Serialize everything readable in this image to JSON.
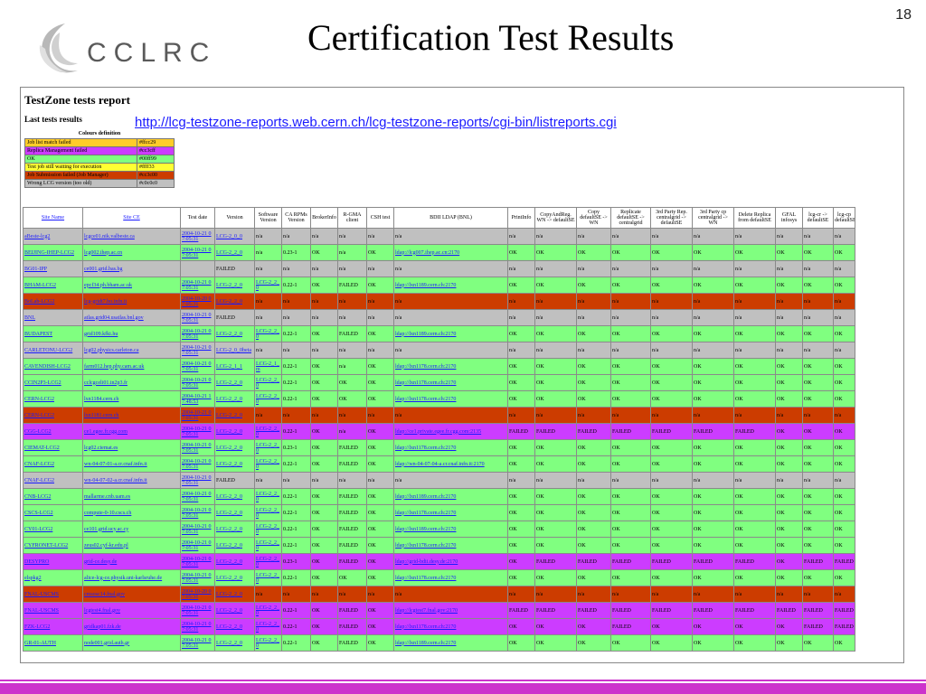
{
  "slide": {
    "number": "18",
    "title": "Certification Test Results",
    "logo_text": "CCLRC"
  },
  "report": {
    "title": "TestZone tests report",
    "last_results": "Last tests results",
    "url": "http://lcg-testzone-reports.web.cern.ch/lcg-testzone-reports/cgi-bin/listreports.cgi"
  },
  "legend": {
    "header": "Colours definition",
    "items": [
      {
        "label": "Job list match failed",
        "code": "#ffcc29",
        "color": "#ffcc29"
      },
      {
        "label": "Replica Management failed",
        "code": "#cc3cff",
        "color": "#cc3cff"
      },
      {
        "label": "OK",
        "code": "#00ff99",
        "color": "#80ff80"
      },
      {
        "label": "Test job still waiting for execution",
        "code": "#ffff33",
        "color": "#ffff33"
      },
      {
        "label": "Job Submission failed (Job Manager)",
        "code": "#cc3c00",
        "color": "#cc3c00"
      },
      {
        "label": "Wrong LCG version (too old)",
        "code": "#c0c0c0",
        "color": "#c0c0c0"
      }
    ]
  },
  "colors": {
    "ok": "#80ff80",
    "fail": "#cc3c00",
    "gray": "#c0c0c0",
    "rm": "#cc3cff",
    "link": "#1a1aff"
  },
  "table": {
    "headers": [
      "Site Name",
      "Site CE",
      "Test date",
      "Version",
      "Software Version",
      "CA RPMs Version",
      "BrokerInfo",
      "R-GMA client",
      "CSH test",
      "BDII LDAP (BNL)",
      "PrintInfo",
      "CopyAndReg. WN -> defaultSE",
      "Copy defaultSE -> WN",
      "Replicate defaultSE -> centralgrid",
      "3rd Party Rep. centralgrid -> defaultSE",
      "3rd Party cp centralgrid -> WN",
      "Delete Replica from defaultSE",
      "GFAL infosys",
      "lcg-cr -> defaultSE",
      "lcg-cp defaultSE"
    ],
    "rows": [
      {
        "row": "gray",
        "cells": [
          "aBeste-lcg2",
          "lcgce01.nik.valbeste.ca",
          "2004-10-21 07:05:31",
          "LCG-2_0_0",
          "n/a",
          "n/a",
          "n/a",
          "n/a",
          "n/a",
          "n/a",
          "n/a",
          "n/a",
          "n/a",
          "n/a",
          "n/a",
          "n/a",
          "n/a",
          "n/a",
          "n/a",
          "n/a"
        ]
      },
      {
        "row": "ok",
        "cells": [
          "BEIJING-IHEP-LCG2",
          "lcg002.ihep.ac.cn",
          "2004-10-21 07:05:31",
          "LCG-2_2_0",
          "n/a",
          "0.23-1",
          "OK",
          "n/a",
          "OK",
          "ldap://lcg007.ihep.ac.cn:2170",
          "OK",
          "OK",
          "OK",
          "OK",
          "OK",
          "OK",
          "OK",
          "OK",
          "OK",
          "OK"
        ]
      },
      {
        "row": "gray",
        "cells": [
          "BG01-IPP",
          "ce001.grid.bas.bg",
          "",
          "FAILED",
          "n/a",
          "n/a",
          "n/a",
          "n/a",
          "n/a",
          "n/a",
          "n/a",
          "n/a",
          "n/a",
          "n/a",
          "n/a",
          "n/a",
          "n/a",
          "n/a",
          "n/a",
          "n/a"
        ]
      },
      {
        "row": "ok",
        "cells": [
          "BHAM-LCG2",
          "epcf34.ph.bham.ac.uk",
          "2004-10-21 07:05:31",
          "LCG-2_2_0",
          "LCG-2_2_0",
          "0.22-1",
          "OK",
          "FAILED",
          "OK",
          "ldap://lxn1189.cern.ch:2170",
          "OK",
          "OK",
          "OK",
          "OK",
          "OK",
          "OK",
          "OK",
          "OK",
          "OK",
          "OK"
        ]
      },
      {
        "row": "fail",
        "cells": [
          "BoLab-LCG2",
          "lcg-gridt7.bo.infn.it",
          "2004-10-20 07:05:31",
          "LCG-2_2_0",
          "n/a",
          "n/a",
          "n/a",
          "n/a",
          "n/a",
          "n/a",
          "n/a",
          "n/a",
          "n/a",
          "n/a",
          "n/a",
          "n/a",
          "n/a",
          "n/a",
          "n/a",
          "n/a"
        ]
      },
      {
        "row": "gray",
        "cells": [
          "BNL",
          "atlas.grid04.usatlas.bnl.gov",
          "2004-10-21 07:05:31",
          "FAILED",
          "n/a",
          "n/a",
          "n/a",
          "n/a",
          "n/a",
          "n/a",
          "n/a",
          "n/a",
          "n/a",
          "n/a",
          "n/a",
          "n/a",
          "n/a",
          "n/a",
          "n/a",
          "n/a"
        ]
      },
      {
        "row": "ok",
        "cells": [
          "BUDAPEST",
          "grid109.kfki.hu",
          "2004-10-21 07:05:31",
          "LCG-2_2_0",
          "LCG-2_2_0",
          "0.22-1",
          "OK",
          "FAILED",
          "OK",
          "ldap://lxn1189.cern.ch:2170",
          "OK",
          "OK",
          "OK",
          "OK",
          "OK",
          "OK",
          "OK",
          "OK",
          "OK",
          "OK"
        ]
      },
      {
        "row": "gray",
        "cells": [
          "CARLETONU-LCG2",
          "lcg02.physics.carleton.ca",
          "2004-10-21 07:05:31",
          "LCG-2_0_0beta",
          "n/a",
          "n/a",
          "n/a",
          "n/a",
          "n/a",
          "n/a",
          "n/a",
          "n/a",
          "n/a",
          "n/a",
          "n/a",
          "n/a",
          "n/a",
          "n/a",
          "n/a",
          "n/a"
        ]
      },
      {
        "row": "ok",
        "cells": [
          "CAVENDISH-LCG2",
          "farm012.hep.phy.cam.ac.uk",
          "2004-10-21 07:05:31",
          "LCG-2_1_1",
          "LCG-2_1_m",
          "0.22-1",
          "OK",
          "n/a",
          "OK",
          "ldap://lxn1178.cern.ch:2170",
          "OK",
          "OK",
          "OK",
          "OK",
          "OK",
          "OK",
          "OK",
          "OK",
          "OK",
          "OK"
        ]
      },
      {
        "row": "ok",
        "cells": [
          "CCIN2P3-LCG2",
          "cclcgceli01.in2p3.fr",
          "2004-10-21 07:05:31",
          "LCG-2_2_0",
          "LCG-2_2_0",
          "0.22-1",
          "OK",
          "OK",
          "OK",
          "ldap://lxn1178.cern.ch:2170",
          "OK",
          "OK",
          "OK",
          "OK",
          "OK",
          "OK",
          "OK",
          "OK",
          "OK",
          "OK"
        ]
      },
      {
        "row": "ok",
        "cells": [
          "CERN-LCG2",
          "lxn1184.cern.ch",
          "2004-10-21 17:48:53",
          "LCG-2_2_0",
          "LCG-2_2_0",
          "0.22-1",
          "OK",
          "OK",
          "OK",
          "ldap://lxn1178.cern.ch:2170",
          "OK",
          "OK",
          "OK",
          "OK",
          "OK",
          "OK",
          "OK",
          "OK",
          "OK",
          "OK"
        ]
      },
      {
        "row": "fail",
        "cells": [
          "CERN-LCG2",
          "lxn1181.cern.ch",
          "2004-10-21 07:05:31",
          "LCG-2_2_0",
          "n/a",
          "n/a",
          "n/a",
          "n/a",
          "n/a",
          "n/a",
          "n/a",
          "n/a",
          "n/a",
          "n/a",
          "n/a",
          "n/a",
          "n/a",
          "n/a",
          "n/a",
          "n/a"
        ]
      },
      {
        "row": "rm",
        "cells": [
          "CGG-LCG2",
          "ce1.egee.fr.cgg.com",
          "2004-10-21 07:05:31",
          "LCG-2_2_0",
          "LCG-2_2_0",
          "0.22-1",
          "OK",
          "n/a",
          "OK",
          "ldap://ce1.private.egee.fr.cgg.com:2135",
          "FAILED",
          "FAILED",
          "FAILED",
          "FAILED",
          "FAILED",
          "FAILED",
          "FAILED",
          "OK",
          "OK",
          "OK"
        ]
      },
      {
        "row": "ok",
        "cells": [
          "CIEMAT-LCG2",
          "lcg02.ciemat.es",
          "2004-10-21 07:05:31",
          "LCG-2_2_0",
          "LCG-2_2_0",
          "0.23-1",
          "OK",
          "FAILED",
          "OK",
          "ldap://lxn1178.cern.ch:2170",
          "OK",
          "OK",
          "OK",
          "OK",
          "OK",
          "OK",
          "OK",
          "OK",
          "OK",
          "OK"
        ]
      },
      {
        "row": "ok",
        "cells": [
          "CNAF-LCG2",
          "wn-04-07-01-a.cr.cnaf.infn.it",
          "2004-10-21 07:05:31",
          "LCG-2_2_0",
          "LCG-2_2_0",
          "0.22-1",
          "OK",
          "FAILED",
          "OK",
          "ldap://wn-04-07-04-a.cr.cnaf.infn.it:2170",
          "OK",
          "OK",
          "OK",
          "OK",
          "OK",
          "OK",
          "OK",
          "OK",
          "OK",
          "OK"
        ]
      },
      {
        "row": "gray",
        "cells": [
          "CNAF-LCG2",
          "wn-04-07-02-a.cr.cnaf.infn.it",
          "2004-10-21 07:05:31",
          "FAILED",
          "n/a",
          "n/a",
          "n/a",
          "n/a",
          "n/a",
          "n/a",
          "n/a",
          "n/a",
          "n/a",
          "n/a",
          "n/a",
          "n/a",
          "n/a",
          "n/a",
          "n/a",
          "n/a"
        ]
      },
      {
        "row": "ok",
        "cells": [
          "CNB-LCG2",
          "mallarme.cnb.uam.es",
          "2004-10-21 07:05:31",
          "LCG-2_2_0",
          "LCG-2_2_0",
          "0.22-1",
          "OK",
          "FAILED",
          "OK",
          "ldap://lxn1189.cern.ch:2170",
          "OK",
          "OK",
          "OK",
          "OK",
          "OK",
          "OK",
          "OK",
          "OK",
          "OK",
          "OK"
        ]
      },
      {
        "row": "ok",
        "cells": [
          "CSCS-LCG2",
          "compute-0-10.cscs.ch",
          "2004-10-21 07:05:31",
          "LCG-2_2_0",
          "LCG-2_2_0",
          "0.22-1",
          "OK",
          "FAILED",
          "OK",
          "ldap://lxn1178.cern.ch:2170",
          "OK",
          "OK",
          "OK",
          "OK",
          "OK",
          "OK",
          "OK",
          "OK",
          "OK",
          "OK"
        ]
      },
      {
        "row": "ok",
        "cells": [
          "CY01-LCG2",
          "ce101.grid.ucy.ac.cy",
          "2004-10-21 07:05:31",
          "LCG-2_2_0",
          "LCG-2_2_0",
          "0.22-1",
          "OK",
          "FAILED",
          "OK",
          "ldap://lxn1189.cern.ch:2170",
          "OK",
          "OK",
          "OK",
          "OK",
          "OK",
          "OK",
          "OK",
          "OK",
          "OK",
          "OK"
        ]
      },
      {
        "row": "ok",
        "cells": [
          "CYFRONET-LCG2",
          "zeus02.cyf-kr.edu.pl",
          "2004-10-21 07:05:31",
          "LCG-2_2_0",
          "LCG-2_2_0",
          "0.22-1",
          "OK",
          "FAILED",
          "OK",
          "ldap://lxn1178.cern.ch:2170",
          "OK",
          "OK",
          "OK",
          "OK",
          "OK",
          "OK",
          "OK",
          "OK",
          "OK",
          "OK"
        ]
      },
      {
        "row": "rm",
        "cells": [
          "DESYPRO",
          "grid-ce.desy.de",
          "2004-10-21 07:05:31",
          "LCG-2_2_0",
          "LCG-2_2_0",
          "0.23-1",
          "OK",
          "FAILED",
          "OK",
          "ldap://grid-bdii.desy.de:2170",
          "OK",
          "FAILED",
          "FAILED",
          "FAILED",
          "FAILED",
          "FAILED",
          "FAILED",
          "OK",
          "FAILED",
          "FAILED"
        ]
      },
      {
        "row": "ok",
        "cells": [
          "elspkg2",
          "alice-lcg-ce.physik.uni-karlsruhe.de",
          "2004-10-21 07:05:31",
          "LCG-2_2_0",
          "LCG-2_2_0",
          "0.22-1",
          "OK",
          "OK",
          "OK",
          "ldap://lxn1178.cern.ch:2170",
          "OK",
          "OK",
          "OK",
          "OK",
          "OK",
          "OK",
          "OK",
          "OK",
          "OK",
          "OK"
        ]
      },
      {
        "row": "fail",
        "cells": [
          "FNAL-USCMS",
          "cmsosc14.fnal.gov",
          "2004-10-20 07:05:31",
          "LCG-2_2_0",
          "n/a",
          "n/a",
          "n/a",
          "n/a",
          "n/a",
          "n/a",
          "n/a",
          "n/a",
          "n/a",
          "n/a",
          "n/a",
          "n/a",
          "n/a",
          "n/a",
          "n/a",
          "n/a"
        ]
      },
      {
        "row": "rm",
        "cells": [
          "FNAL-USCMS",
          "lcgtest4.fnal.gov",
          "2004-10-21 07:05:31",
          "LCG-2_2_0",
          "LCG-2_2_0",
          "0.22-1",
          "OK",
          "FAILED",
          "OK",
          "ldap://lcgtest7.fnal.gov:2170",
          "FAILED",
          "FAILED",
          "FAILED",
          "FAILED",
          "FAILED",
          "FAILED",
          "FAILED",
          "FAILED",
          "FAILED",
          "FAILED"
        ]
      },
      {
        "row": "rm",
        "cells": [
          "FZK-LCG2",
          "gridkap01.fzk.de",
          "2004-10-21 07:05:31",
          "LCG-2_2_0",
          "LCG-2_2_0",
          "0.22-1",
          "OK",
          "FAILED",
          "OK",
          "ldap://lxn1178.cern.ch:2170",
          "OK",
          "OK",
          "OK",
          "FAILED",
          "OK",
          "OK",
          "OK",
          "OK",
          "FAILED",
          "FAILED"
        ]
      },
      {
        "row": "ok",
        "cells": [
          "GR-01-AUTH",
          "node001.grid.auth.gr",
          "2004-10-21 07:05:31",
          "LCG-2_2_0",
          "LCG-2_2_0",
          "0.22-1",
          "OK",
          "FAILED",
          "OK",
          "ldap://lxn1189.cern.ch:2170",
          "OK",
          "OK",
          "OK",
          "OK",
          "OK",
          "OK",
          "OK",
          "OK",
          "OK",
          "OK"
        ]
      }
    ]
  }
}
